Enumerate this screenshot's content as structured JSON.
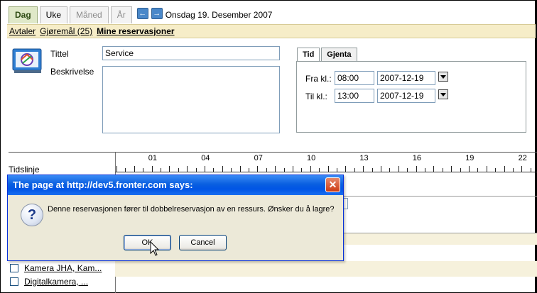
{
  "view_tabs": [
    {
      "label": "Dag",
      "state": "active"
    },
    {
      "label": "Uke",
      "state": "normal"
    },
    {
      "label": "Måned",
      "state": "disabled"
    },
    {
      "label": "År",
      "state": "disabled"
    }
  ],
  "nav": {
    "prev_icon": "arrow-left-icon",
    "next_icon": "arrow-right-icon"
  },
  "date_title": "Onsdag 19. Desember 2007",
  "subnav": {
    "items": [
      {
        "label": "Avtaler"
      },
      {
        "label": "Gjøremål (25)"
      },
      {
        "label": "Mine reservasjoner"
      }
    ]
  },
  "form": {
    "icon": "calendar-app-icon",
    "title_label": "Tittel",
    "title_value": "Service",
    "description_label": "Beskrivelse",
    "description_value": ""
  },
  "time_panel": {
    "tabs": [
      {
        "label": "Tid"
      },
      {
        "label": "Gjenta"
      }
    ],
    "from_label": "Fra kl.:",
    "from_time": "08:00",
    "from_date": "2007-12-19",
    "to_label": "Til kl.:",
    "to_time": "13:00",
    "to_date": "2007-12-19"
  },
  "timeline": {
    "label": "Tidslinje",
    "hours": [
      "01",
      "04",
      "07",
      "10",
      "13",
      "16",
      "19",
      "22"
    ]
  },
  "resources": [
    {
      "label": "Kamera JHA, Kam..."
    },
    {
      "label": "Digitalkamera, ..."
    }
  ],
  "dialog": {
    "title": "The page at http://dev5.fronter.com says:",
    "message": "Denne reservasjonen fører til dobbelreservasjon av en ressurs. Ønsker du å lagre?",
    "ok_label": "OK",
    "cancel_label": "Cancel",
    "close_icon": "close-icon",
    "question_icon": "question-icon"
  }
}
